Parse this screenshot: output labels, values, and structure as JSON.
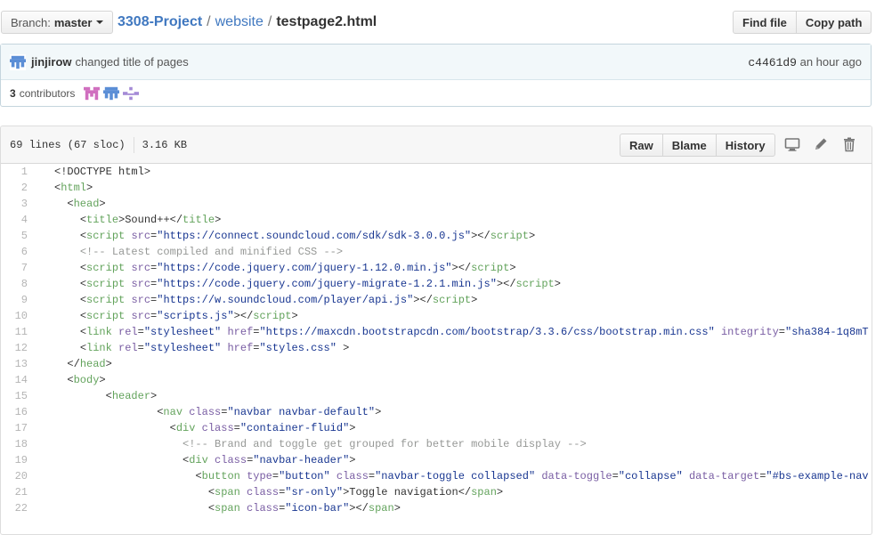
{
  "topbar": {
    "branch_label": "Branch:",
    "branch_name": "master",
    "breadcrumb": {
      "repo": "3308-Project",
      "dir": "website",
      "file": "testpage2.html",
      "separator": "/"
    },
    "find_file_label": "Find file",
    "copy_path_label": "Copy path"
  },
  "commit": {
    "author": "jinjirow",
    "message": "changed title of pages",
    "sha": "c4461d9",
    "time": "an hour ago",
    "contributors_count": "3",
    "contributors_label": "contributors"
  },
  "file": {
    "lines": "69 lines (67 sloc)",
    "size": "3.16 KB",
    "raw_label": "Raw",
    "blame_label": "Blame",
    "history_label": "History",
    "icons": [
      "desktop-icon",
      "pencil-icon",
      "trash-icon"
    ]
  },
  "code_lines": [
    {
      "n": "1",
      "indent": "",
      "tokens": [
        [
          "txt",
          "<!DOCTYPE html>"
        ]
      ]
    },
    {
      "n": "2",
      "indent": "",
      "tokens": [
        [
          "txt",
          "<"
        ],
        [
          "tag",
          "html"
        ],
        [
          "txt",
          ">"
        ]
      ]
    },
    {
      "n": "3",
      "indent": "  ",
      "tokens": [
        [
          "txt",
          "<"
        ],
        [
          "tag",
          "head"
        ],
        [
          "txt",
          ">"
        ]
      ]
    },
    {
      "n": "4",
      "indent": "    ",
      "tokens": [
        [
          "txt",
          "<"
        ],
        [
          "tag",
          "title"
        ],
        [
          "txt",
          ">Sound++</"
        ],
        [
          "tag",
          "title"
        ],
        [
          "txt",
          ">"
        ]
      ]
    },
    {
      "n": "5",
      "indent": "    ",
      "tokens": [
        [
          "txt",
          "<"
        ],
        [
          "tag",
          "script"
        ],
        [
          "txt",
          " "
        ],
        [
          "attr",
          "src"
        ],
        [
          "txt",
          "="
        ],
        [
          "str",
          "\"https://connect.soundcloud.com/sdk/sdk-3.0.0.js\""
        ],
        [
          "txt",
          "></"
        ],
        [
          "tag",
          "script"
        ],
        [
          "txt",
          ">"
        ]
      ]
    },
    {
      "n": "6",
      "indent": "    ",
      "tokens": [
        [
          "cmt",
          "<!-- Latest compiled and minified CSS -->"
        ]
      ]
    },
    {
      "n": "7",
      "indent": "    ",
      "tokens": [
        [
          "txt",
          "<"
        ],
        [
          "tag",
          "script"
        ],
        [
          "txt",
          " "
        ],
        [
          "attr",
          "src"
        ],
        [
          "txt",
          "="
        ],
        [
          "str",
          "\"https://code.jquery.com/jquery-1.12.0.min.js\""
        ],
        [
          "txt",
          "></"
        ],
        [
          "tag",
          "script"
        ],
        [
          "txt",
          ">"
        ]
      ]
    },
    {
      "n": "8",
      "indent": "    ",
      "tokens": [
        [
          "txt",
          "<"
        ],
        [
          "tag",
          "script"
        ],
        [
          "txt",
          " "
        ],
        [
          "attr",
          "src"
        ],
        [
          "txt",
          "="
        ],
        [
          "str",
          "\"https://code.jquery.com/jquery-migrate-1.2.1.min.js\""
        ],
        [
          "txt",
          "></"
        ],
        [
          "tag",
          "script"
        ],
        [
          "txt",
          ">"
        ]
      ]
    },
    {
      "n": "9",
      "indent": "    ",
      "tokens": [
        [
          "txt",
          "<"
        ],
        [
          "tag",
          "script"
        ],
        [
          "txt",
          " "
        ],
        [
          "attr",
          "src"
        ],
        [
          "txt",
          "="
        ],
        [
          "str",
          "\"https://w.soundcloud.com/player/api.js\""
        ],
        [
          "txt",
          "></"
        ],
        [
          "tag",
          "script"
        ],
        [
          "txt",
          ">"
        ]
      ]
    },
    {
      "n": "10",
      "indent": "    ",
      "tokens": [
        [
          "txt",
          "<"
        ],
        [
          "tag",
          "script"
        ],
        [
          "txt",
          " "
        ],
        [
          "attr",
          "src"
        ],
        [
          "txt",
          "="
        ],
        [
          "str",
          "\"scripts.js\""
        ],
        [
          "txt",
          "></"
        ],
        [
          "tag",
          "script"
        ],
        [
          "txt",
          ">"
        ]
      ]
    },
    {
      "n": "11",
      "indent": "    ",
      "tokens": [
        [
          "txt",
          "<"
        ],
        [
          "tag",
          "link"
        ],
        [
          "txt",
          " "
        ],
        [
          "attr",
          "rel"
        ],
        [
          "txt",
          "="
        ],
        [
          "str",
          "\"stylesheet\""
        ],
        [
          "txt",
          " "
        ],
        [
          "attr",
          "href"
        ],
        [
          "txt",
          "="
        ],
        [
          "str",
          "\"https://maxcdn.bootstrapcdn.com/bootstrap/3.3.6/css/bootstrap.min.css\""
        ],
        [
          "txt",
          " "
        ],
        [
          "attr",
          "integrity"
        ],
        [
          "txt",
          "="
        ],
        [
          "str",
          "\"sha384-1q8mT"
        ]
      ]
    },
    {
      "n": "12",
      "indent": "    ",
      "tokens": [
        [
          "txt",
          "<"
        ],
        [
          "tag",
          "link"
        ],
        [
          "txt",
          " "
        ],
        [
          "attr",
          "rel"
        ],
        [
          "txt",
          "="
        ],
        [
          "str",
          "\"stylesheet\""
        ],
        [
          "txt",
          " "
        ],
        [
          "attr",
          "href"
        ],
        [
          "txt",
          "="
        ],
        [
          "str",
          "\"styles.css\""
        ],
        [
          "txt",
          " >"
        ]
      ]
    },
    {
      "n": "13",
      "indent": "  ",
      "tokens": [
        [
          "txt",
          "</"
        ],
        [
          "tag",
          "head"
        ],
        [
          "txt",
          ">"
        ]
      ]
    },
    {
      "n": "14",
      "indent": "  ",
      "tokens": [
        [
          "txt",
          "<"
        ],
        [
          "tag",
          "body"
        ],
        [
          "txt",
          ">"
        ]
      ]
    },
    {
      "n": "15",
      "indent": "        ",
      "tokens": [
        [
          "txt",
          "<"
        ],
        [
          "tag",
          "header"
        ],
        [
          "txt",
          ">"
        ]
      ]
    },
    {
      "n": "16",
      "indent": "                ",
      "tokens": [
        [
          "txt",
          "<"
        ],
        [
          "tag",
          "nav"
        ],
        [
          "txt",
          " "
        ],
        [
          "attr",
          "class"
        ],
        [
          "txt",
          "="
        ],
        [
          "str",
          "\"navbar navbar-default\""
        ],
        [
          "txt",
          ">"
        ]
      ]
    },
    {
      "n": "17",
      "indent": "                  ",
      "tokens": [
        [
          "txt",
          "<"
        ],
        [
          "tag",
          "div"
        ],
        [
          "txt",
          " "
        ],
        [
          "attr",
          "class"
        ],
        [
          "txt",
          "="
        ],
        [
          "str",
          "\"container-fluid\""
        ],
        [
          "txt",
          ">"
        ]
      ]
    },
    {
      "n": "18",
      "indent": "                    ",
      "tokens": [
        [
          "cmt",
          "<!-- Brand and toggle get grouped for better mobile display -->"
        ]
      ]
    },
    {
      "n": "19",
      "indent": "                    ",
      "tokens": [
        [
          "txt",
          "<"
        ],
        [
          "tag",
          "div"
        ],
        [
          "txt",
          " "
        ],
        [
          "attr",
          "class"
        ],
        [
          "txt",
          "="
        ],
        [
          "str",
          "\"navbar-header\""
        ],
        [
          "txt",
          ">"
        ]
      ]
    },
    {
      "n": "20",
      "indent": "                      ",
      "tokens": [
        [
          "txt",
          "<"
        ],
        [
          "tag",
          "button"
        ],
        [
          "txt",
          " "
        ],
        [
          "attr",
          "type"
        ],
        [
          "txt",
          "="
        ],
        [
          "str",
          "\"button\""
        ],
        [
          "txt",
          " "
        ],
        [
          "attr",
          "class"
        ],
        [
          "txt",
          "="
        ],
        [
          "str",
          "\"navbar-toggle collapsed\""
        ],
        [
          "txt",
          " "
        ],
        [
          "attr",
          "data-toggle"
        ],
        [
          "txt",
          "="
        ],
        [
          "str",
          "\"collapse\""
        ],
        [
          "txt",
          " "
        ],
        [
          "attr",
          "data-target"
        ],
        [
          "txt",
          "="
        ],
        [
          "str",
          "\"#bs-example-nav"
        ]
      ]
    },
    {
      "n": "21",
      "indent": "                        ",
      "tokens": [
        [
          "txt",
          "<"
        ],
        [
          "tag",
          "span"
        ],
        [
          "txt",
          " "
        ],
        [
          "attr",
          "class"
        ],
        [
          "txt",
          "="
        ],
        [
          "str",
          "\"sr-only\""
        ],
        [
          "txt",
          ">Toggle navigation</"
        ],
        [
          "tag",
          "span"
        ],
        [
          "txt",
          ">"
        ]
      ]
    },
    {
      "n": "22",
      "indent": "                        ",
      "tokens": [
        [
          "txt",
          "<"
        ],
        [
          "tag",
          "span"
        ],
        [
          "txt",
          " "
        ],
        [
          "attr",
          "class"
        ],
        [
          "txt",
          "="
        ],
        [
          "str",
          "\"icon-bar\""
        ],
        [
          "txt",
          "></"
        ],
        [
          "tag",
          "span"
        ],
        [
          "txt",
          ">"
        ]
      ]
    }
  ]
}
